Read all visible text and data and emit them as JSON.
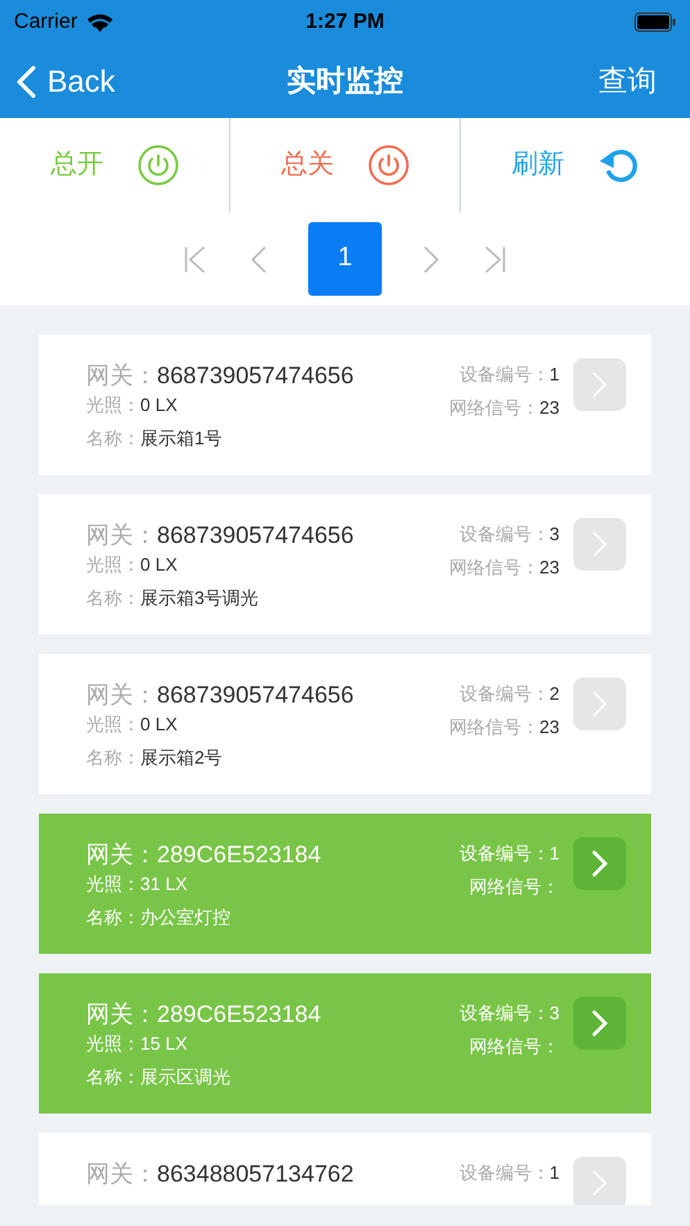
{
  "status_bar": {
    "carrier": "Carrier",
    "time": "1:27 PM"
  },
  "nav": {
    "back": "Back",
    "title": "实时监控",
    "action": "查询"
  },
  "toolbar": [
    {
      "kind": "on",
      "label": "总开"
    },
    {
      "kind": "off",
      "label": "总关"
    },
    {
      "kind": "refresh",
      "label": "刷新"
    }
  ],
  "pagination": {
    "pages": [
      {
        "label": "1",
        "selected": true
      }
    ]
  },
  "cards": [
    {
      "online": false,
      "gateway_label": "网关：",
      "gateway": "868739057474656",
      "light_label": "光照：",
      "light": "0 LX",
      "name_label": "名称：",
      "name": "展示箱1号",
      "device_no_label": "设备编号：",
      "device_no": "1",
      "signal_label": "网络信号：",
      "signal": "23"
    },
    {
      "online": false,
      "gateway_label": "网关：",
      "gateway": "868739057474656",
      "light_label": "光照：",
      "light": "0 LX",
      "name_label": "名称：",
      "name": "展示箱3号调光",
      "device_no_label": "设备编号：",
      "device_no": "3",
      "signal_label": "网络信号：",
      "signal": "23"
    },
    {
      "online": false,
      "gateway_label": "网关：",
      "gateway": "868739057474656",
      "light_label": "光照：",
      "light": "0 LX",
      "name_label": "名称：",
      "name": "展示箱2号",
      "device_no_label": "设备编号：",
      "device_no": "2",
      "signal_label": "网络信号：",
      "signal": "23"
    },
    {
      "online": true,
      "gateway_label": "网关：",
      "gateway": "289C6E523184",
      "light_label": "光照：",
      "light": "31 LX",
      "name_label": "名称：",
      "name": "办公室灯控",
      "device_no_label": "设备编号：",
      "device_no": "1",
      "signal_label": "网络信号："
    },
    {
      "online": true,
      "gateway_label": "网关：",
      "gateway": "289C6E523184",
      "light_label": "光照：",
      "light": "15 LX",
      "name_label": "名称：",
      "name": "展示区调光",
      "device_no_label": "设备编号：",
      "device_no": "3",
      "signal_label": "网络信号："
    },
    {
      "online": false,
      "gateway_label": "网关：",
      "gateway": "863488057134762",
      "device_no_label": "设备编号：",
      "device_no": "1"
    }
  ]
}
